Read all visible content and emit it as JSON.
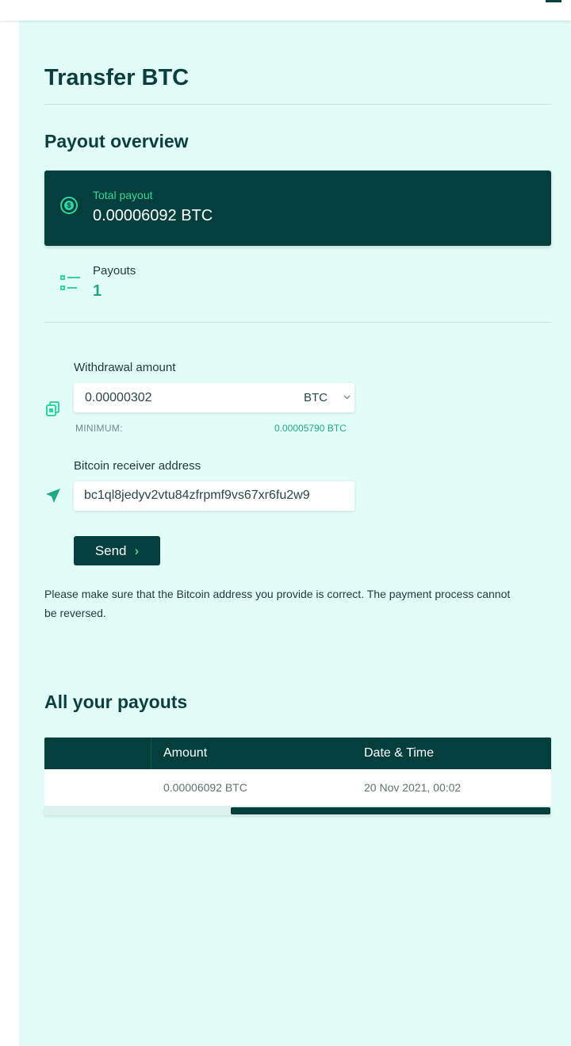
{
  "header": {
    "menu_icon": "hamburger-icon"
  },
  "page": {
    "title": "Transfer BTC"
  },
  "overview": {
    "heading": "Payout overview",
    "total_payout_label": "Total payout",
    "total_payout_value": "0.00006092 BTC",
    "total_icon": "coin-icon",
    "payouts_label": "Payouts",
    "payouts_value": "1",
    "payouts_icon": "list-icon"
  },
  "form": {
    "withdrawal_label": "Withdrawal amount",
    "withdrawal_value": "0.00000302",
    "currency_selected": "BTC",
    "minimum_label": "MINIMUM:",
    "minimum_value": "0.00005790 BTC",
    "address_label": "Bitcoin receiver address",
    "address_value": "bc1ql8jedyv2vtu84zfrpmf9vs67xr6fu2w9",
    "send_label": "Send",
    "warning": "Please make sure that the Bitcoin address you provide is correct. The payment process cannot be reversed."
  },
  "payouts_table": {
    "heading": "All your payouts",
    "columns": [
      "",
      "Amount",
      "Date & Time"
    ],
    "rows": [
      {
        "amount": "0.00006092 BTC",
        "datetime": "20 Nov 2021, 00:02"
      }
    ]
  },
  "colors": {
    "primary_dark": "#053f3d",
    "accent_green": "#2fd79c",
    "panel_bg": "#e2fcf8"
  }
}
